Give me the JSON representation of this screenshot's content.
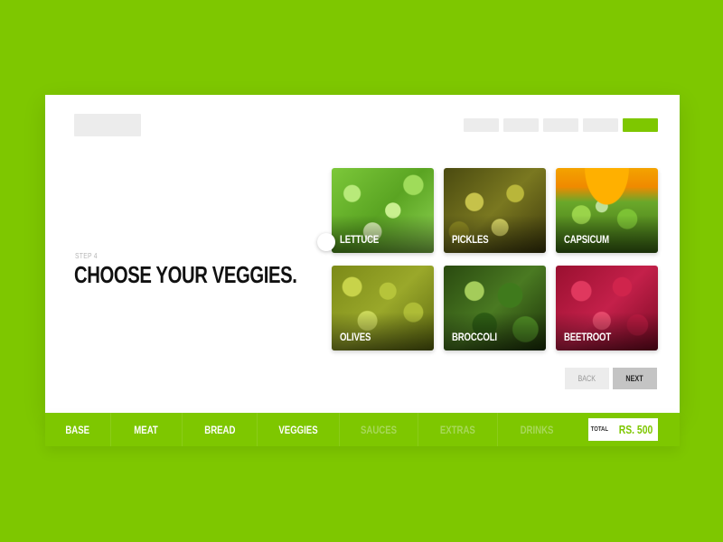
{
  "header": {
    "logo_placeholder": "logo",
    "progress": {
      "total_steps": 5,
      "current_step": 5
    }
  },
  "step": {
    "label": "STEP 4",
    "title": "CHOOSE YOUR VEGGIES."
  },
  "veggies": [
    {
      "name": "LETTUCE",
      "selected": true
    },
    {
      "name": "PICKLES",
      "selected": false
    },
    {
      "name": "CAPSICUM",
      "selected": false
    },
    {
      "name": "OLIVES",
      "selected": false
    },
    {
      "name": "BROCCOLI",
      "selected": false
    },
    {
      "name": "BEETROOT",
      "selected": false
    }
  ],
  "actions": {
    "back_label": "BACK",
    "next_label": "NEXT"
  },
  "nav": {
    "items": [
      {
        "label": "BASE",
        "state": "done"
      },
      {
        "label": "MEAT",
        "state": "done"
      },
      {
        "label": "BREAD",
        "state": "done"
      },
      {
        "label": "VEGGIES",
        "state": "done"
      },
      {
        "label": "SAUCES",
        "state": "todo"
      },
      {
        "label": "EXTRAS",
        "state": "todo"
      },
      {
        "label": "DRINKS",
        "state": "todo"
      }
    ],
    "total_label": "TOTAL",
    "total_value": "RS. 500"
  },
  "colors": {
    "accent": "#7ec700",
    "card": "#ffffff",
    "placeholder": "#ececec"
  }
}
